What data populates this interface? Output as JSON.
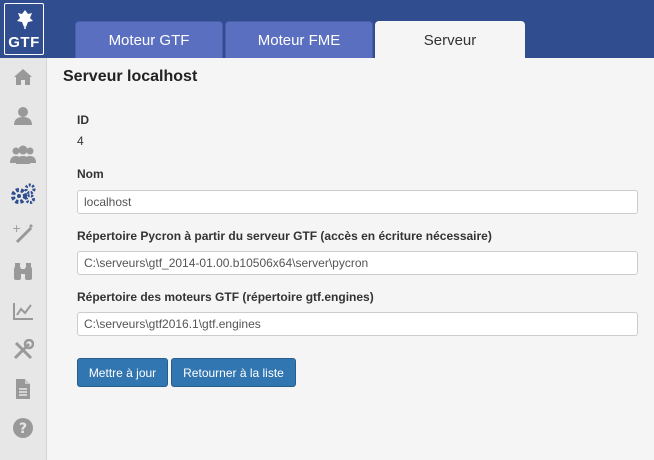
{
  "brand": {
    "name": "GTF"
  },
  "tabs": [
    {
      "label": "Moteur GTF",
      "active": false
    },
    {
      "label": "Moteur FME",
      "active": false
    },
    {
      "label": "Serveur",
      "active": true
    }
  ],
  "sidebar": {
    "items": [
      {
        "icon": "home-icon"
      },
      {
        "icon": "user-icon"
      },
      {
        "icon": "users-icon"
      },
      {
        "icon": "gears-icon",
        "active": true
      },
      {
        "icon": "magic-wand-icon"
      },
      {
        "icon": "binoculars-icon"
      },
      {
        "icon": "line-chart-icon"
      },
      {
        "icon": "tools-icon"
      },
      {
        "icon": "file-icon"
      },
      {
        "icon": "help-icon"
      }
    ],
    "active_color": "#2f4d8f",
    "icon_color": "#999999"
  },
  "page": {
    "title": "Serveur localhost",
    "id_label": "ID",
    "id_value": "4",
    "name_label": "Nom",
    "name_value": "localhost",
    "pycron_label": "Répertoire Pycron à partir du serveur GTF (accès en écriture nécessaire)",
    "pycron_value": "C:\\serveurs\\gtf_2014-01.00.b10506x64\\server\\pycron",
    "engines_label": "Répertoire des moteurs GTF (répertoire gtf.engines)",
    "engines_value": "C:\\serveurs\\gtf2016.1\\gtf.engines"
  },
  "actions": {
    "update_label": "Mettre à jour",
    "back_label": "Retourner à la liste"
  },
  "colors": {
    "brand": "#2f4d8f",
    "tab": "#5b6fc0",
    "button": "#3276b1"
  }
}
